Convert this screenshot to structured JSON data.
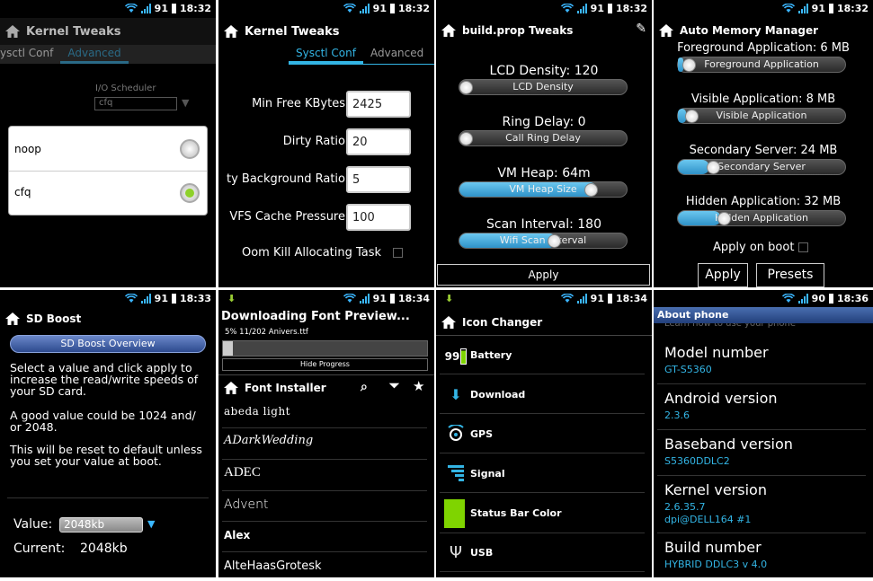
{
  "panes": {
    "p1": {
      "status": {
        "signal": "91",
        "time": "18:32"
      },
      "title": "Kernel Tweaks",
      "tabs": [
        "ysctl Conf",
        "Advanced"
      ],
      "io_label": "I/O Scheduler",
      "io_value": "cfq",
      "options": [
        "noop",
        "cfq"
      ],
      "selected_option": "cfq"
    },
    "p2": {
      "status": {
        "signal": "91",
        "time": "18:32"
      },
      "title": "Kernel Tweaks",
      "tabs": [
        "Sysctl Conf",
        "Advanced"
      ],
      "fields": [
        {
          "label": "Min Free KBytes",
          "value": "2425"
        },
        {
          "label": "Dirty Ratio",
          "value": "20"
        },
        {
          "label": "ty Background Ratio",
          "value": "5"
        },
        {
          "label": "VFS Cache Pressure",
          "value": "100"
        }
      ],
      "oom_label": "Oom Kill Allocating Task"
    },
    "p3": {
      "status": {
        "signal": "91",
        "time": "18:32"
      },
      "title": "build.prop Tweaks",
      "items": [
        {
          "title": "LCD Density: 120",
          "slider": "LCD Density",
          "level": 0.0
        },
        {
          "title": "Ring Delay: 0",
          "slider": "Call Ring Delay",
          "level": 0.0
        },
        {
          "title": "VM Heap: 64m",
          "slider": "VM Heap Size",
          "level": 0.82
        },
        {
          "title": "Scan Interval: 180",
          "slider": "Wifi Scan Interval",
          "level": 0.58
        }
      ],
      "apply": "Apply"
    },
    "p4": {
      "status": {
        "signal": "91",
        "time": "18:32"
      },
      "title": "Auto Memory Manager",
      "items": [
        {
          "title": "Foreground Application: 6 MB",
          "slider": "Foreground Application",
          "level": 0.03
        },
        {
          "title": "Visible Application: 8 MB",
          "slider": "Visible Application",
          "level": 0.05
        },
        {
          "title": "Secondary Server: 24 MB",
          "slider": "Secondary Server",
          "level": 0.19
        },
        {
          "title": "Hidden Application: 32 MB",
          "slider": "Hidden Application",
          "level": 0.26
        }
      ],
      "apply_on_boot": "Apply on boot",
      "apply": "Apply",
      "presets": "Presets"
    },
    "p5": {
      "status": {
        "signal": "91",
        "time": "18:33"
      },
      "title": "SD Boost",
      "overview_button": "SD Boost Overview",
      "text1": "Select a value and click apply to increase the read/write speeds of your SD card.",
      "text2": "A good value could be 1024 and/ or 2048.",
      "text3": "This will be reset to default unless you set your value at boot.",
      "value_label": "Value:",
      "value": "2048kb",
      "current_label": "Current:",
      "current": "2048kb"
    },
    "p6": {
      "status": {
        "signal": "91",
        "time": "18:34"
      },
      "download_title": "Downloading Font Preview...",
      "progress_text": "5% 11/202 Anivers.ttf",
      "progress": 0.05,
      "hide_progress": "Hide Progress",
      "title": "Font Installer",
      "fonts": [
        "abeda light",
        "ADarkWedding",
        "ADEC",
        "Advent",
        "Alex",
        "AlteHaasGrotesk"
      ]
    },
    "p7": {
      "status": {
        "signal": "91",
        "time": "18:34"
      },
      "title": "Icon Changer",
      "battery_level": "99",
      "items": [
        {
          "label": "Battery",
          "icon": "battery-icon"
        },
        {
          "label": "Download",
          "icon": "download-icon"
        },
        {
          "label": "GPS",
          "icon": "gps-icon"
        },
        {
          "label": "Signal",
          "icon": "signal-icon"
        },
        {
          "label": "Status Bar Color",
          "icon": "color-swatch-icon"
        },
        {
          "label": "USB",
          "icon": "usb-icon"
        }
      ],
      "colors": {
        "swatch": "#7fd400",
        "accent": "#33b5e5"
      }
    },
    "p8": {
      "status": {
        "signal": "90",
        "time": "18:36"
      },
      "title": "About phone",
      "partial": "Learn how to use your phone",
      "entries": [
        {
          "label": "Model number",
          "value": "GT-S5360"
        },
        {
          "label": "Android version",
          "value": "2.3.6"
        },
        {
          "label": "Baseband version",
          "value": "S5360DDLC2"
        },
        {
          "label": "Kernel version",
          "value": "2.6.35.7",
          "value2": "dpi@DELL164 #1"
        },
        {
          "label": "Build number",
          "value": "HYBRID DDLC3 v 4.0"
        }
      ]
    }
  }
}
